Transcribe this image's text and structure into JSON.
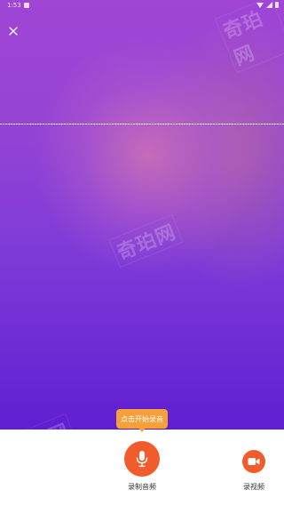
{
  "status_bar": {
    "time": "1:53"
  },
  "watermark": {
    "text": "奇珀网"
  },
  "tooltip": {
    "text": "点击开始录音"
  },
  "controls": {
    "record_audio_label": "录制音频",
    "record_video_label": "录视频"
  },
  "colors": {
    "accent": "#f25c2c",
    "tooltip": "#f7a03a",
    "background_top": "#a045d6",
    "background_bottom": "#5f1fd1"
  },
  "icons": {
    "close": "close-icon",
    "microphone": "microphone-icon",
    "video_camera": "video-camera-icon"
  }
}
